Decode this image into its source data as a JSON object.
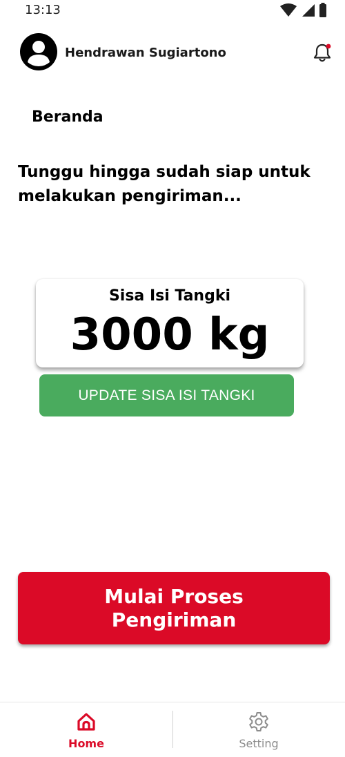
{
  "status_bar": {
    "time": "13:13"
  },
  "header": {
    "user_name": "Hendrawan Sugiartono"
  },
  "page": {
    "title": "Beranda",
    "message": "Tunggu hingga sudah siap untuk melakukan pengiriman..."
  },
  "tank": {
    "label": "Sisa Isi Tangki",
    "value": "3000 kg",
    "update_button": "UPDATE SISA ISI TANGKI"
  },
  "start_button": {
    "label": "Mulai Proses Pengiriman"
  },
  "bottom_nav": {
    "items": [
      {
        "label": "Home",
        "icon": "home-icon",
        "active": true
      },
      {
        "label": "Setting",
        "icon": "gear-icon",
        "active": false
      }
    ]
  },
  "colors": {
    "brand_red": "#db0a27",
    "update_green": "#4aab5e",
    "inactive_gray": "#8c8c8c"
  }
}
